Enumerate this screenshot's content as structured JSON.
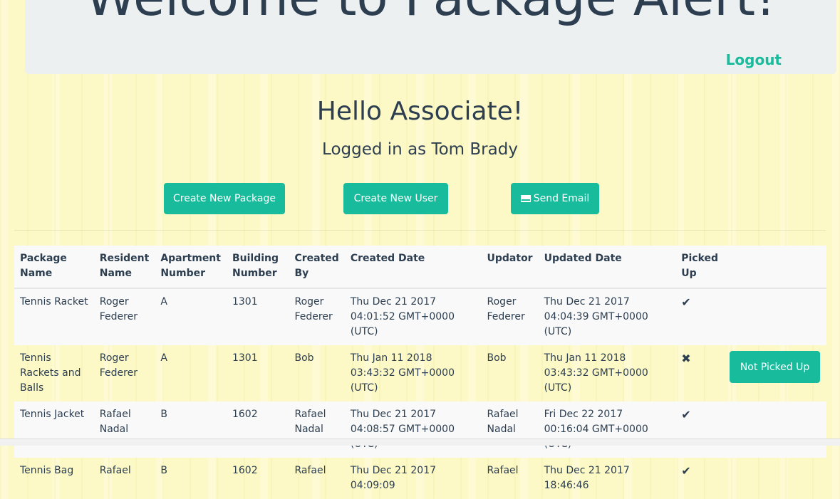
{
  "header": {
    "title": "Welcome to Package Alert!",
    "logout_label": "Logout"
  },
  "greeting": "Hello Associate!",
  "logged_in_text": "Logged in as Tom Brady",
  "actions": {
    "create_package": "Create New Package",
    "create_user": "Create New User",
    "send_email": "Send Email"
  },
  "table": {
    "headers": [
      "Package Name",
      "Resident Name",
      "Apartment Number",
      "Building Number",
      "Created By",
      "Created Date",
      "Updator",
      "Updated Date",
      "Picked Up",
      ""
    ],
    "rows": [
      {
        "package": "Tennis Racket",
        "resident": "Roger Federer",
        "apartment": "A",
        "building": "1301",
        "created_by": "Roger Federer",
        "created_date": "Thu Dec 21 2017 04:01:52 GMT+0000 (UTC)",
        "updator": "Roger Federer",
        "updated_date": "Thu Dec 21 2017 04:04:39 GMT+0000 (UTC)",
        "picked_up": "✔",
        "action": ""
      },
      {
        "package": "Tennis Rackets and Balls",
        "resident": "Roger Federer",
        "apartment": "A",
        "building": "1301",
        "created_by": "Bob",
        "created_date": "Thu Jan 11 2018 03:43:32 GMT+0000 (UTC)",
        "updator": "Bob",
        "updated_date": "Thu Jan 11 2018 03:43:32 GMT+0000 (UTC)",
        "picked_up": "✖",
        "action": "Not Picked Up"
      },
      {
        "package": "Tennis Jacket",
        "resident": "Rafael Nadal",
        "apartment": "B",
        "building": "1602",
        "created_by": "Rafael Nadal",
        "created_date": "Thu Dec 21 2017 04:08:57 GMT+0000 (UTC)",
        "updator": "Rafael Nadal",
        "updated_date": "Fri Dec 22 2017 00:16:04 GMT+0000 (UTC)",
        "picked_up": "✔",
        "action": ""
      },
      {
        "package": "Tennis Bag",
        "resident": "Rafael",
        "apartment": "B",
        "building": "1602",
        "created_by": "Rafael",
        "created_date": "Thu Dec 21 2017 04:09:09",
        "updator": "Rafael",
        "updated_date": "Thu Dec 21 2017 18:46:46",
        "picked_up": "✔",
        "action": ""
      }
    ]
  },
  "colors": {
    "accent": "#18bc9c",
    "text": "#2c3e50",
    "jumbotron": "#ecf0f1",
    "background": "#fdf9c6"
  }
}
